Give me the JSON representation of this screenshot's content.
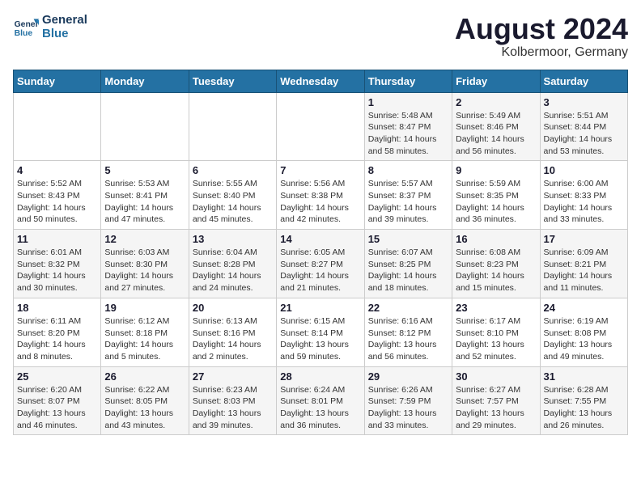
{
  "header": {
    "logo_line1": "General",
    "logo_line2": "Blue",
    "month_title": "August 2024",
    "subtitle": "Kolbermoor, Germany"
  },
  "calendar": {
    "weekdays": [
      "Sunday",
      "Monday",
      "Tuesday",
      "Wednesday",
      "Thursday",
      "Friday",
      "Saturday"
    ],
    "weeks": [
      [
        {
          "day": "",
          "detail": ""
        },
        {
          "day": "",
          "detail": ""
        },
        {
          "day": "",
          "detail": ""
        },
        {
          "day": "",
          "detail": ""
        },
        {
          "day": "1",
          "detail": "Sunrise: 5:48 AM\nSunset: 8:47 PM\nDaylight: 14 hours\nand 58 minutes."
        },
        {
          "day": "2",
          "detail": "Sunrise: 5:49 AM\nSunset: 8:46 PM\nDaylight: 14 hours\nand 56 minutes."
        },
        {
          "day": "3",
          "detail": "Sunrise: 5:51 AM\nSunset: 8:44 PM\nDaylight: 14 hours\nand 53 minutes."
        }
      ],
      [
        {
          "day": "4",
          "detail": "Sunrise: 5:52 AM\nSunset: 8:43 PM\nDaylight: 14 hours\nand 50 minutes."
        },
        {
          "day": "5",
          "detail": "Sunrise: 5:53 AM\nSunset: 8:41 PM\nDaylight: 14 hours\nand 47 minutes."
        },
        {
          "day": "6",
          "detail": "Sunrise: 5:55 AM\nSunset: 8:40 PM\nDaylight: 14 hours\nand 45 minutes."
        },
        {
          "day": "7",
          "detail": "Sunrise: 5:56 AM\nSunset: 8:38 PM\nDaylight: 14 hours\nand 42 minutes."
        },
        {
          "day": "8",
          "detail": "Sunrise: 5:57 AM\nSunset: 8:37 PM\nDaylight: 14 hours\nand 39 minutes."
        },
        {
          "day": "9",
          "detail": "Sunrise: 5:59 AM\nSunset: 8:35 PM\nDaylight: 14 hours\nand 36 minutes."
        },
        {
          "day": "10",
          "detail": "Sunrise: 6:00 AM\nSunset: 8:33 PM\nDaylight: 14 hours\nand 33 minutes."
        }
      ],
      [
        {
          "day": "11",
          "detail": "Sunrise: 6:01 AM\nSunset: 8:32 PM\nDaylight: 14 hours\nand 30 minutes."
        },
        {
          "day": "12",
          "detail": "Sunrise: 6:03 AM\nSunset: 8:30 PM\nDaylight: 14 hours\nand 27 minutes."
        },
        {
          "day": "13",
          "detail": "Sunrise: 6:04 AM\nSunset: 8:28 PM\nDaylight: 14 hours\nand 24 minutes."
        },
        {
          "day": "14",
          "detail": "Sunrise: 6:05 AM\nSunset: 8:27 PM\nDaylight: 14 hours\nand 21 minutes."
        },
        {
          "day": "15",
          "detail": "Sunrise: 6:07 AM\nSunset: 8:25 PM\nDaylight: 14 hours\nand 18 minutes."
        },
        {
          "day": "16",
          "detail": "Sunrise: 6:08 AM\nSunset: 8:23 PM\nDaylight: 14 hours\nand 15 minutes."
        },
        {
          "day": "17",
          "detail": "Sunrise: 6:09 AM\nSunset: 8:21 PM\nDaylight: 14 hours\nand 11 minutes."
        }
      ],
      [
        {
          "day": "18",
          "detail": "Sunrise: 6:11 AM\nSunset: 8:20 PM\nDaylight: 14 hours\nand 8 minutes."
        },
        {
          "day": "19",
          "detail": "Sunrise: 6:12 AM\nSunset: 8:18 PM\nDaylight: 14 hours\nand 5 minutes."
        },
        {
          "day": "20",
          "detail": "Sunrise: 6:13 AM\nSunset: 8:16 PM\nDaylight: 14 hours\nand 2 minutes."
        },
        {
          "day": "21",
          "detail": "Sunrise: 6:15 AM\nSunset: 8:14 PM\nDaylight: 13 hours\nand 59 minutes."
        },
        {
          "day": "22",
          "detail": "Sunrise: 6:16 AM\nSunset: 8:12 PM\nDaylight: 13 hours\nand 56 minutes."
        },
        {
          "day": "23",
          "detail": "Sunrise: 6:17 AM\nSunset: 8:10 PM\nDaylight: 13 hours\nand 52 minutes."
        },
        {
          "day": "24",
          "detail": "Sunrise: 6:19 AM\nSunset: 8:08 PM\nDaylight: 13 hours\nand 49 minutes."
        }
      ],
      [
        {
          "day": "25",
          "detail": "Sunrise: 6:20 AM\nSunset: 8:07 PM\nDaylight: 13 hours\nand 46 minutes."
        },
        {
          "day": "26",
          "detail": "Sunrise: 6:22 AM\nSunset: 8:05 PM\nDaylight: 13 hours\nand 43 minutes."
        },
        {
          "day": "27",
          "detail": "Sunrise: 6:23 AM\nSunset: 8:03 PM\nDaylight: 13 hours\nand 39 minutes."
        },
        {
          "day": "28",
          "detail": "Sunrise: 6:24 AM\nSunset: 8:01 PM\nDaylight: 13 hours\nand 36 minutes."
        },
        {
          "day": "29",
          "detail": "Sunrise: 6:26 AM\nSunset: 7:59 PM\nDaylight: 13 hours\nand 33 minutes."
        },
        {
          "day": "30",
          "detail": "Sunrise: 6:27 AM\nSunset: 7:57 PM\nDaylight: 13 hours\nand 29 minutes."
        },
        {
          "day": "31",
          "detail": "Sunrise: 6:28 AM\nSunset: 7:55 PM\nDaylight: 13 hours\nand 26 minutes."
        }
      ]
    ]
  }
}
